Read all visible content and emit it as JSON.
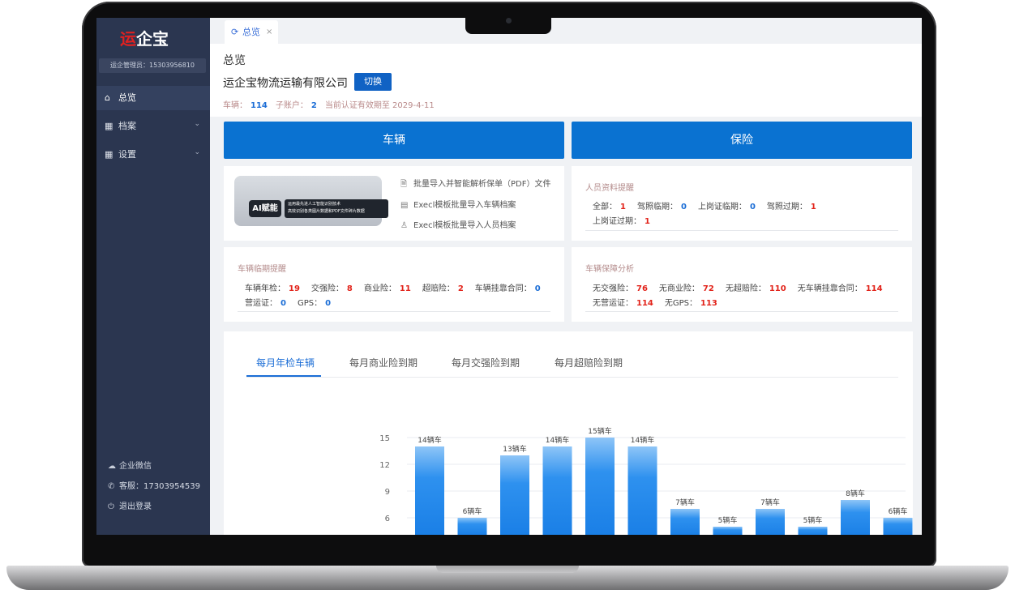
{
  "sidebar": {
    "logo_red": "运",
    "logo_white": "企宝",
    "admin_label": "运企管理员：15303956810",
    "items": [
      {
        "label": "总览",
        "icon": "home-icon"
      },
      {
        "label": "档案",
        "icon": "grid-icon"
      },
      {
        "label": "设置",
        "icon": "grid-icon"
      }
    ],
    "footer": {
      "wechat": "企业微信",
      "service": "客服：17303954539",
      "logout": "退出登录"
    }
  },
  "tabs": [
    {
      "label": "总览",
      "close": "×"
    }
  ],
  "header": {
    "page_title": "总览",
    "company": "运企宝物流运输有限公司",
    "switch_label": "切换",
    "vehicles_label": "车辆：",
    "vehicles_value": "114",
    "subaccounts_label": "子账户：",
    "subaccounts_value": "2",
    "valid_until": "当前认证有效期至  2029-4-11"
  },
  "banners": {
    "vehicles": "车辆",
    "insurance": "保险"
  },
  "ai_card": {
    "badge": "AI赋能",
    "line1": "运用最先进人工智能识别技术",
    "line2": "高效识别各类图片数据和PDF文件碎片数据",
    "actions": [
      "批量导入并智能解析保单（PDF）文件",
      "Execl模板批量导入车辆档案",
      "Execl模板批量导入人员档案"
    ]
  },
  "personnel": {
    "title": "人员资料提醒",
    "items": [
      {
        "label": "全部：",
        "value": "1"
      },
      {
        "label": "驾照临期：",
        "value": "0"
      },
      {
        "label": "上岗证临期：",
        "value": "0"
      },
      {
        "label": "驾照过期：",
        "value": "1"
      },
      {
        "label": "上岗证过期：",
        "value": "1"
      }
    ]
  },
  "vehicle_expiry": {
    "title": "车辆临期提醒",
    "items": [
      {
        "label": "车辆年检：",
        "value": "19"
      },
      {
        "label": "交强险：",
        "value": "8"
      },
      {
        "label": "商业险：",
        "value": "11"
      },
      {
        "label": "超赔险：",
        "value": "2"
      },
      {
        "label": "车辆挂靠合同：",
        "value": "0"
      },
      {
        "label": "营运证：",
        "value": "0"
      },
      {
        "label": "GPS：",
        "value": "0"
      }
    ]
  },
  "coverage": {
    "title": "车辆保障分析",
    "items": [
      {
        "label": "无交强险：",
        "value": "76"
      },
      {
        "label": "无商业险：",
        "value": "72"
      },
      {
        "label": "无超赔险：",
        "value": "110"
      },
      {
        "label": "无车辆挂靠合同：",
        "value": "114"
      },
      {
        "label": "无营运证：",
        "value": "114"
      },
      {
        "label": "无GPS：",
        "value": "113"
      }
    ]
  },
  "chart_tabs": [
    "每月年检车辆",
    "每月商业险到期",
    "每月交强险到期",
    "每月超赔险到期"
  ],
  "colors": {
    "primary": "#0a72d1",
    "sidebar": "#2b3650",
    "alert": "#e2231a",
    "link": "#1c6ed6"
  },
  "chart_data": {
    "type": "bar",
    "values": [
      14,
      6,
      13,
      14,
      15,
      14,
      7,
      5,
      7,
      5,
      8,
      6
    ],
    "data_labels": [
      "14辆车",
      "6辆车",
      "13辆车",
      "14辆车",
      "15辆车",
      "14辆车",
      "7辆车",
      "5辆车",
      "7辆车",
      "5辆车",
      "8辆车",
      "6辆车"
    ],
    "y_ticks": [
      "15",
      "12",
      "9",
      "6"
    ],
    "ylim_visible": [
      5.4,
      15
    ],
    "grid": true
  }
}
